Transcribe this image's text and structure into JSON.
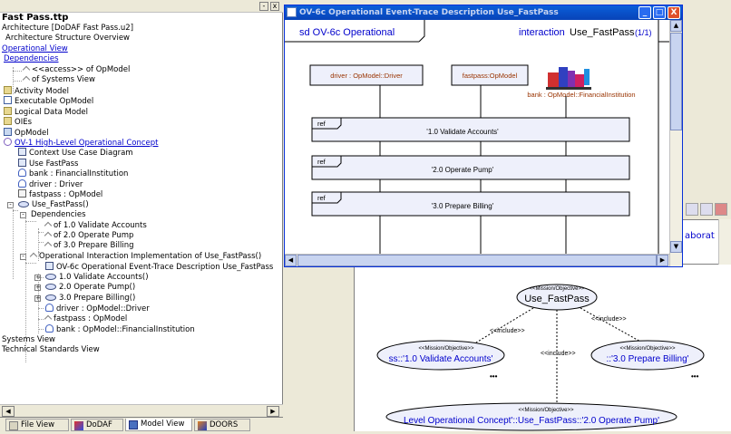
{
  "left_panel": {
    "title": "Fast Pass.ttp",
    "tree": [
      {
        "label": "Architecture [DoDAF Fast Pass.u2]",
        "link": false
      },
      {
        "label": "Architecture Structure Overview",
        "link": false
      },
      {
        "label": "Operational View",
        "link": true
      },
      {
        "label": "Dependencies",
        "link": true
      },
      {
        "label": "<<access>> of OpModel",
        "link": false
      },
      {
        "label": "of Systems View",
        "link": false
      },
      {
        "label": "Activity Model",
        "link": false
      },
      {
        "label": "Executable OpModel",
        "link": false
      },
      {
        "label": "Logical Data Model",
        "link": false
      },
      {
        "label": "OIEs",
        "link": false
      },
      {
        "label": "OpModel",
        "link": false
      },
      {
        "label": "OV-1 High-Level Operational Concept",
        "link": true
      },
      {
        "label": "Context Use Case Diagram",
        "link": false
      },
      {
        "label": "Use FastPass",
        "link": false
      },
      {
        "label": "bank : FinancialInstitution",
        "link": false
      },
      {
        "label": "driver : Driver",
        "link": false
      },
      {
        "label": "fastpass : OpModel",
        "link": false
      },
      {
        "label": "Use_FastPass()",
        "link": false
      },
      {
        "label": "Dependencies",
        "link": false
      },
      {
        "label": "of 1.0 Validate Accounts",
        "link": false
      },
      {
        "label": "of 2.0 Operate Pump",
        "link": false
      },
      {
        "label": "of 3.0 Prepare Billing",
        "link": false
      },
      {
        "label": "Operational Interaction Implementation of Use_FastPass()",
        "link": false
      },
      {
        "label": "OV-6c Operational Event-Trace Description  Use_FastPass",
        "link": false
      },
      {
        "label": "1.0 Validate Accounts()",
        "link": false
      },
      {
        "label": "2.0 Operate Pump()",
        "link": false
      },
      {
        "label": "3.0 Prepare Billing()",
        "link": false
      },
      {
        "label": "driver : OpModel::Driver",
        "link": false
      },
      {
        "label": "fastpass : OpModel",
        "link": false
      },
      {
        "label": "bank : OpModel::FinancialInstitution",
        "link": false
      },
      {
        "label": "Systems View",
        "link": false
      },
      {
        "label": "Technical Standards View",
        "link": false
      }
    ],
    "tabs": [
      "File View",
      "DoDAF",
      "Model View",
      "DOORS"
    ],
    "header_buttons": [
      "-",
      "x"
    ]
  },
  "seq_window": {
    "title": "OV-6c Operational Event-Trace Description  Use_FastPass",
    "frame_label": "sd OV-6c Operational",
    "interaction_label": "interaction",
    "interaction_name": "Use_FastPass",
    "page": "(1/1)",
    "lifelines": [
      "driver : OpModel::Driver",
      "fastpass:OpModel",
      "bank : OpModel::FinancialInstitution"
    ],
    "refs": [
      {
        "tag": "ref",
        "label": "'1.0 Validate Accounts'"
      },
      {
        "tag": "ref",
        "label": "'2.0 Operate Pump'"
      },
      {
        "tag": "ref",
        "label": "'3.0 Prepare Billing'"
      }
    ]
  },
  "bg_window": {
    "side_text": "aborat",
    "stereotype": "<<Mission/Objective>>",
    "main_usecase": "Use_FastPass",
    "include": "<<include>>",
    "uc1": "ss::'1.0 Validate Accounts'",
    "uc3": "::'3.0 Prepare Billing'",
    "uc2": "Level Operational Concept'::Use_FastPass::'2.0 Operate Pump'",
    "dots": "•••"
  },
  "colors": {
    "link": "#0000cc",
    "titlebar": "#0843b8",
    "ref_fill": "#eef0fb"
  }
}
